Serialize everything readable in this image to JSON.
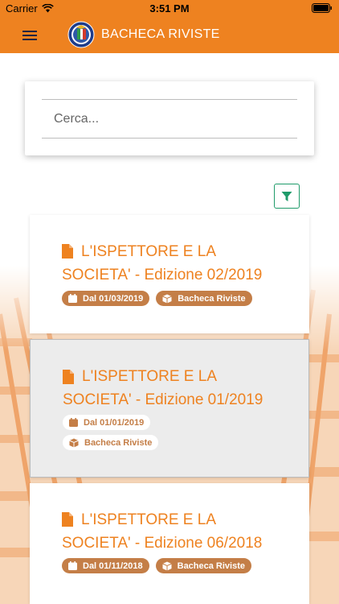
{
  "status_bar": {
    "carrier": "Carrier",
    "time": "3:51 PM"
  },
  "header": {
    "title": "BACHECA RIVISTE"
  },
  "search": {
    "placeholder": "Cerca..."
  },
  "cards": [
    {
      "title_line1": "L'ISPETTORE E LA",
      "title_line2": "SOCIETA' - Edizione 02/2019",
      "date": "Dal 01/03/2019",
      "category": "Bacheca Riviste"
    },
    {
      "title_line1": "L'ISPETTORE E LA",
      "title_line2": "SOCIETA' - Edizione 01/2019",
      "date": "Dal 01/01/2019",
      "category": "Bacheca Riviste"
    },
    {
      "title_line1": "L'ISPETTORE E LA",
      "title_line2": "SOCIETA' - Edizione 06/2018",
      "date": "Dal 01/11/2018",
      "category": "Bacheca Riviste"
    }
  ],
  "colors": {
    "accent": "#ee8220",
    "badge": "#c47e47",
    "filter": "#1f9b6a"
  },
  "icons": {
    "menu": "hamburger-icon",
    "filter": "funnel-icon",
    "document": "document-icon",
    "date": "calendar-icon",
    "category": "cube-icon"
  }
}
